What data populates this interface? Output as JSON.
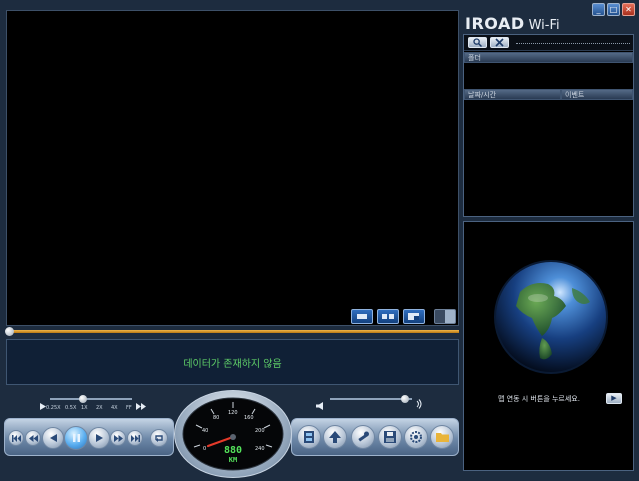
{
  "app": {
    "brand": "IROAD",
    "brand_suffix": "Wi-Fi"
  },
  "window_controls": {
    "minimize": "_",
    "maximize": "□",
    "close": "✕"
  },
  "video": {
    "message": "데이터가 존재하지 않음",
    "layout_buttons": [
      "single-view",
      "dual-view",
      "pip-view",
      "side-panel-toggle"
    ]
  },
  "speed_control": {
    "labels": [
      "0.25X",
      "0.5X",
      "1X",
      "2X",
      "4X",
      "FF"
    ]
  },
  "gauge": {
    "ticks": [
      "0",
      "40",
      "80",
      "120",
      "160",
      "200",
      "240"
    ],
    "speed_display": "880",
    "unit": "KM"
  },
  "file_panel": {
    "folder_header": "폴더",
    "datetime_header": "날짜/시간",
    "event_header": "이벤트"
  },
  "globe_panel": {
    "hint": "맵 연동 시 버튼을 누르세요.",
    "play_glyph": "▶"
  },
  "colors": {
    "accent_blue": "#2f6ec0",
    "message_green": "#5fcf68",
    "progress_orange": "#f0b64a"
  }
}
